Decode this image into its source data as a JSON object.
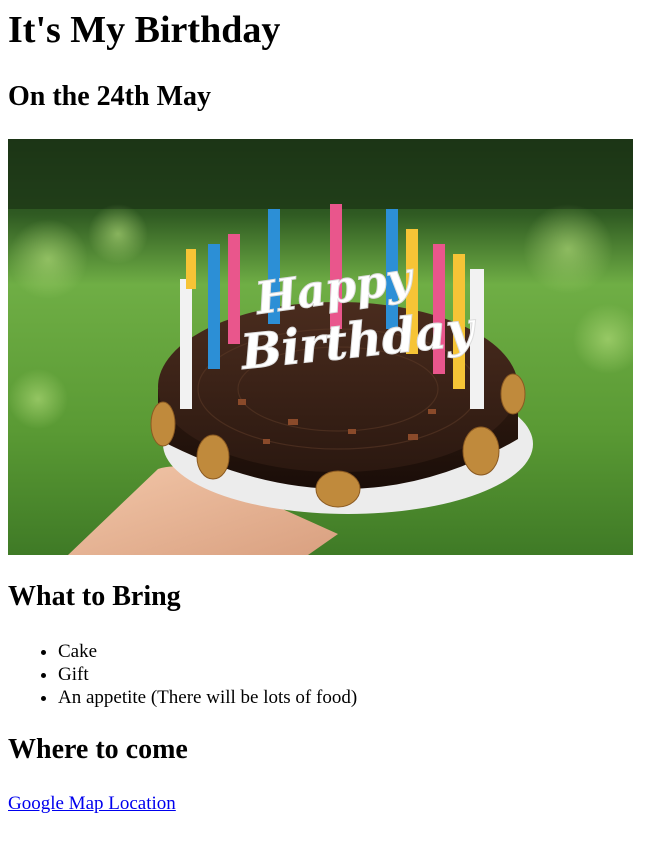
{
  "page": {
    "title": "It's My Birthday",
    "subtitle": "On the 24th May"
  },
  "hero_image": {
    "alt": "",
    "icon": "birthday-cake-photo",
    "cake_topper": {
      "line1": "Happy",
      "line2": "Birthday"
    }
  },
  "bring": {
    "heading": "What to Bring",
    "items": [
      "Cake",
      "Gift",
      "An appetite (There will be lots of food)"
    ]
  },
  "where": {
    "heading": "Where to come",
    "link_label": "Google Map Location"
  },
  "colors": {
    "link": "#0000ee",
    "text": "#000000"
  }
}
